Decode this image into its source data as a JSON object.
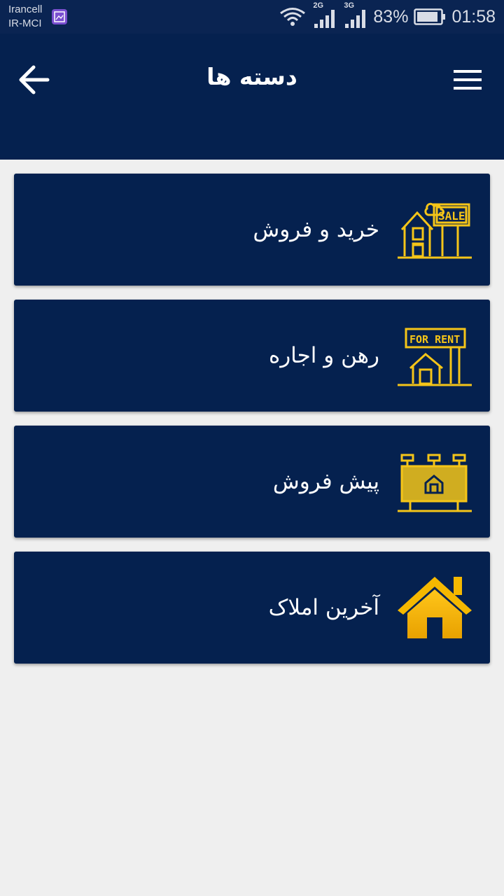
{
  "status_bar": {
    "carrier_1": "Irancell",
    "carrier_2": "IR-MCI",
    "net_1": "2G",
    "net_2": "3G",
    "battery": "83%",
    "time": "01:58"
  },
  "app_bar": {
    "title": "دسته ها",
    "back_icon": "arrow-left-icon",
    "menu_icon": "hamburger-menu-icon"
  },
  "categories": [
    {
      "label": "خرید و فروش",
      "icon": "house-for-sale-icon"
    },
    {
      "label": "رهن و اجاره",
      "icon": "house-for-rent-icon"
    },
    {
      "label": "پیش فروش",
      "icon": "billboard-presale-icon"
    },
    {
      "label": "آخرین املاک",
      "icon": "home-icon"
    }
  ],
  "colors": {
    "primary": "#05214f",
    "accent": "#f5c518",
    "background": "#efefef"
  }
}
